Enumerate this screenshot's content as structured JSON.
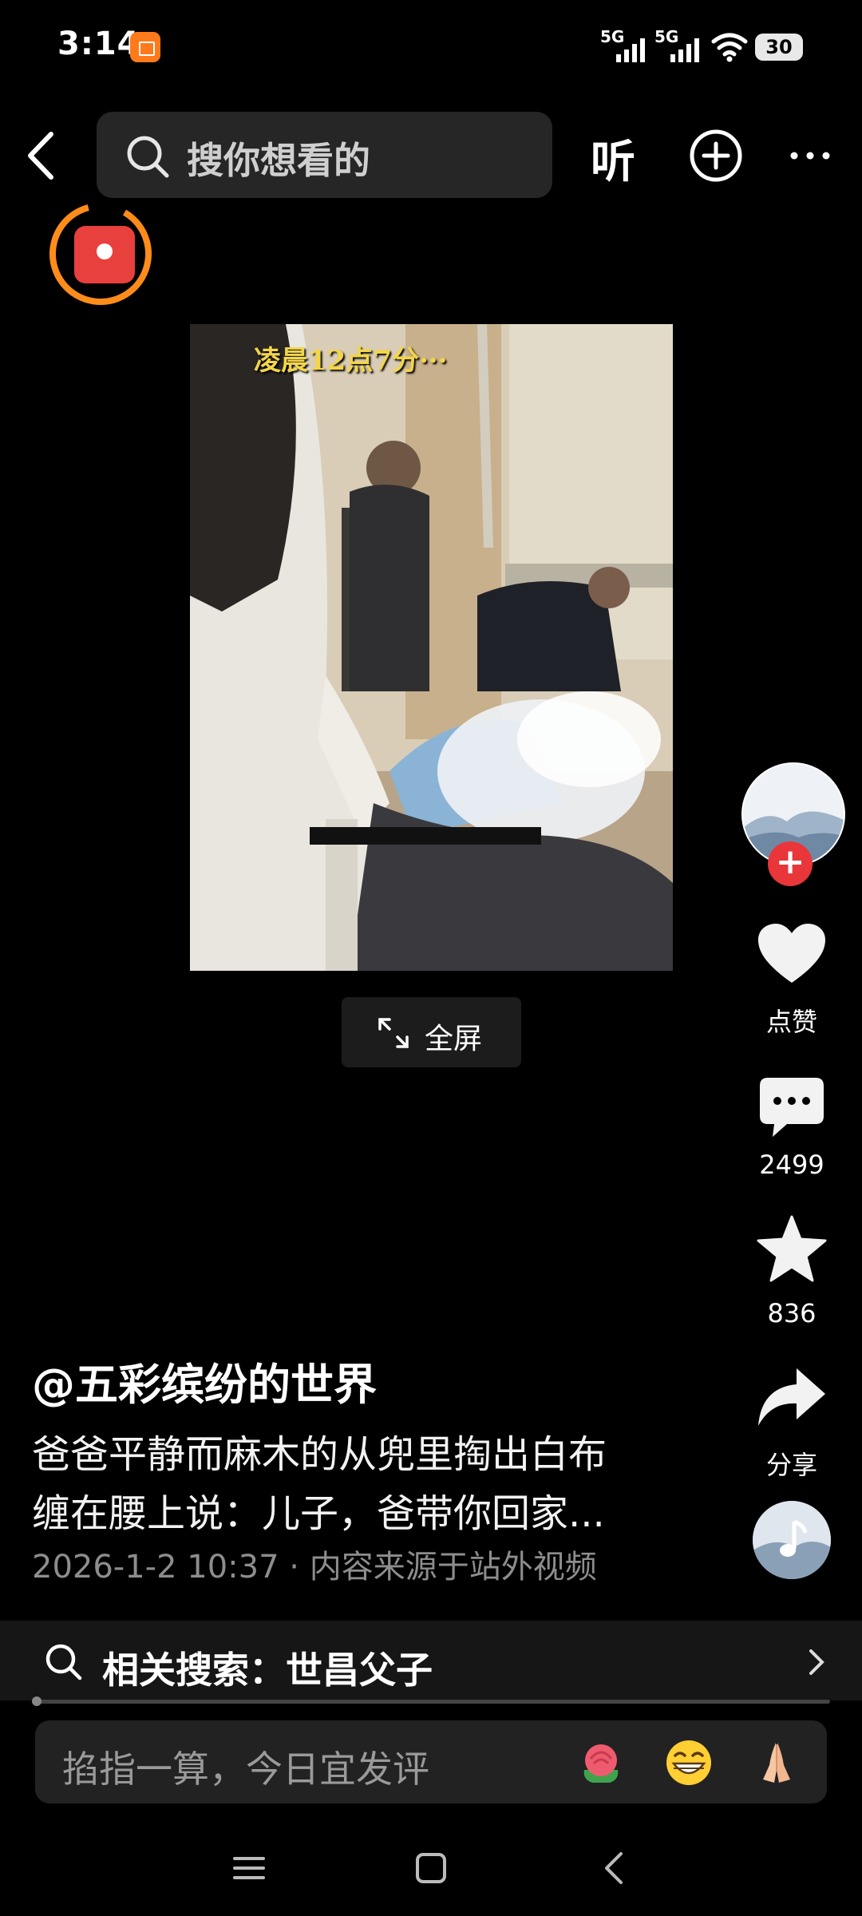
{
  "status_bar": {
    "time": "3:14",
    "signal1_label": "5G",
    "signal2_label": "5G",
    "battery": "30"
  },
  "top_nav": {
    "search_placeholder": "搜你想看的",
    "listen_label": "听"
  },
  "video": {
    "caption_overlay": "凌晨12点7分···",
    "fullscreen_label": "全屏"
  },
  "actions": {
    "like_label": "点赞",
    "comment_count": "2499",
    "favorite_count": "836",
    "share_label": "分享"
  },
  "post": {
    "author": "@五彩缤纷的世界",
    "description_line1": "爸爸平静而麻木的从兜里掏出白布",
    "description_line2": "缠在腰上说：儿子，爸带你回家...",
    "date": "2026-1-2 10:37",
    "source": "内容来源于站外视频"
  },
  "related_search": {
    "label": "相关搜索：世昌父子"
  },
  "comment_input": {
    "placeholder": "掐指一算，今日宜发评",
    "emojis": [
      "rose-emoji",
      "grin-emoji",
      "pray-emoji"
    ]
  },
  "colors": {
    "accent_orange": "#ff8c1a",
    "red": "#e8363a",
    "background": "#000000"
  }
}
